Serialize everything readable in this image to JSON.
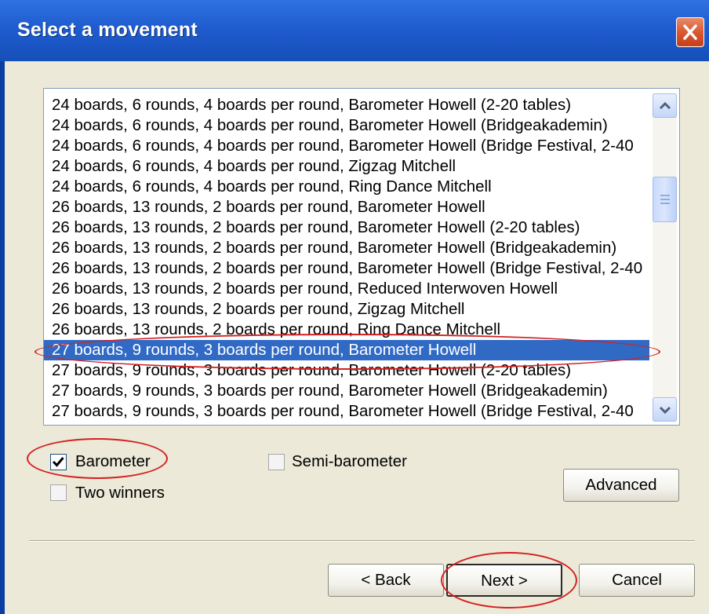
{
  "window": {
    "title": "Select a movement"
  },
  "movements": {
    "items": [
      "24 boards, 6 rounds, 4 boards per round, Barometer Howell (2-20 tables)",
      "24 boards, 6 rounds, 4 boards per round, Barometer Howell (Bridgeakademin)",
      "24 boards, 6 rounds, 4 boards per round, Barometer Howell (Bridge Festival, 2-40",
      "24 boards, 6 rounds, 4 boards per round, Zigzag Mitchell",
      "24 boards, 6 rounds, 4 boards per round, Ring Dance Mitchell",
      "26 boards, 13 rounds, 2 boards per round, Barometer Howell",
      "26 boards, 13 rounds, 2 boards per round, Barometer Howell (2-20 tables)",
      "26 boards, 13 rounds, 2 boards per round, Barometer Howell (Bridgeakademin)",
      "26 boards, 13 rounds, 2 boards per round, Barometer Howell (Bridge Festival, 2-40",
      "26 boards, 13 rounds, 2 boards per round, Reduced Interwoven Howell",
      "26 boards, 13 rounds, 2 boards per round, Zigzag Mitchell",
      "26 boards, 13 rounds, 2 boards per round, Ring Dance Mitchell",
      "27 boards, 9 rounds, 3 boards per round, Barometer Howell",
      "27 boards, 9 rounds, 3 boards per round, Barometer Howell (2-20 tables)",
      "27 boards, 9 rounds, 3 boards per round, Barometer Howell (Bridgeakademin)",
      "27 boards, 9 rounds, 3 boards per round, Barometer Howell (Bridge Festival, 2-40"
    ],
    "selected_index": 12,
    "scroll_position": 0.25
  },
  "options": {
    "barometer": {
      "label": "Barometer",
      "checked": true
    },
    "semi_barometer": {
      "label": "Semi-barometer",
      "checked": false
    },
    "two_winners": {
      "label": "Two winners",
      "checked": false
    }
  },
  "buttons": {
    "advanced": "Advanced",
    "back": "< Back",
    "next": "Next >",
    "cancel": "Cancel"
  },
  "colors": {
    "titlebar": "#1f5ccf",
    "selection": "#316ac5",
    "annotation": "#d42020",
    "dialog_bg": "#ece9d8"
  },
  "icons": {
    "close": "close-icon",
    "scroll_up": "chevron-up-icon",
    "scroll_down": "chevron-down-icon",
    "check": "checkmark-icon"
  }
}
